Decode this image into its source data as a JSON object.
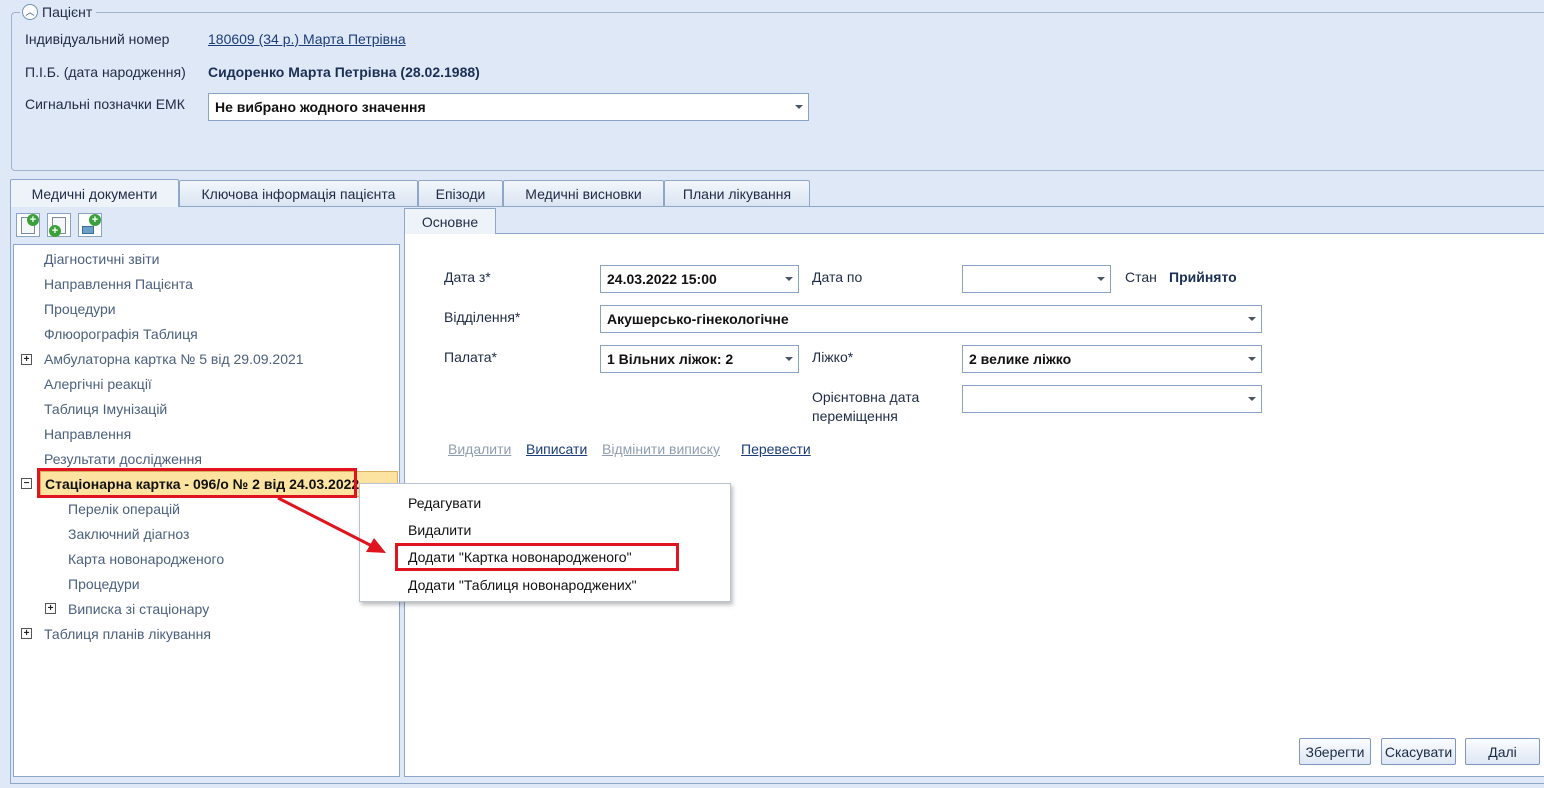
{
  "patient": {
    "legend": "Пацієнт",
    "id_label": "Індивідуальний номер",
    "id_value": "180609 (34 р.) Марта Петрівна",
    "name_label": "П.І.Б. (дата народження)",
    "name_value": "Сидоренко Марта Петрівна (28.02.1988)",
    "flags_label": "Сигнальні позначки ЕМК",
    "flags_value": "Не вибрано жодного значення"
  },
  "tabs": [
    {
      "label": "Медичні документи",
      "active": true
    },
    {
      "label": "Ключова інформація пацієнта",
      "active": false
    },
    {
      "label": "Епізоди",
      "active": false
    },
    {
      "label": "Медичні висновки",
      "active": false
    },
    {
      "label": "Плани лікування",
      "active": false
    }
  ],
  "toolbar": {
    "icons": [
      "add-document-icon",
      "add-copy-icon",
      "add-record-icon"
    ]
  },
  "tree": {
    "items": [
      {
        "label": "Діагностичні звіти",
        "expander": null
      },
      {
        "label": "Направлення Пацієнта",
        "expander": null
      },
      {
        "label": "Процедури",
        "expander": null
      },
      {
        "label": "Флюорографія Таблиця",
        "expander": null
      },
      {
        "label": "Амбулаторна картка № 5 від 29.09.2021",
        "expander": "+"
      },
      {
        "label": "Алергічні реакції",
        "expander": null
      },
      {
        "label": "Таблиця Імунізацій",
        "expander": null
      },
      {
        "label": "Направлення",
        "expander": null
      },
      {
        "label": "Результати дослідження",
        "expander": null
      }
    ],
    "selected": {
      "label": "Стаціонарна картка - 096/о № 2 від 24.03.2022",
      "expander": "−"
    },
    "children": [
      {
        "label": "Перелік операцій",
        "expander": null
      },
      {
        "label": "Заключний діагноз",
        "expander": null
      },
      {
        "label": "Карта новонародженого",
        "expander": null
      },
      {
        "label": "Процедури",
        "expander": null
      },
      {
        "label": "Виписка зі стаціонару",
        "expander": "+"
      }
    ],
    "last": {
      "label": "Таблиця планів лікування",
      "expander": "+"
    }
  },
  "subtab": {
    "label": "Основне"
  },
  "form": {
    "date_from_label": "Дата з*",
    "date_from_value": "24.03.2022 15:00",
    "date_to_label": "Дата по",
    "date_to_value": "",
    "status_label": "Стан",
    "status_value": "Прийнято",
    "department_label": "Відділення*",
    "department_value": "Акушерсько-гінекологічне",
    "ward_label": "Палата*",
    "ward_value": "1 Вільних ліжок: 2",
    "bed_label": "Ліжко*",
    "bed_value": "2 велике ліжко",
    "transfer_label_line1": "Орієнтовна дата",
    "transfer_label_line2": "переміщення",
    "transfer_value": ""
  },
  "actions": {
    "delete": "Видалити",
    "discharge": "Виписати",
    "cancel_discharge": "Відмінити виписку",
    "transfer": "Перевести"
  },
  "buttons": {
    "save": "Зберегти",
    "cancel": "Скасувати",
    "next": "Далі"
  },
  "context_menu": {
    "items": [
      "Редагувати",
      "Видалити",
      "Додати \"Картка новонародженого\"",
      "Додати \"Таблиця новонароджених\""
    ]
  }
}
